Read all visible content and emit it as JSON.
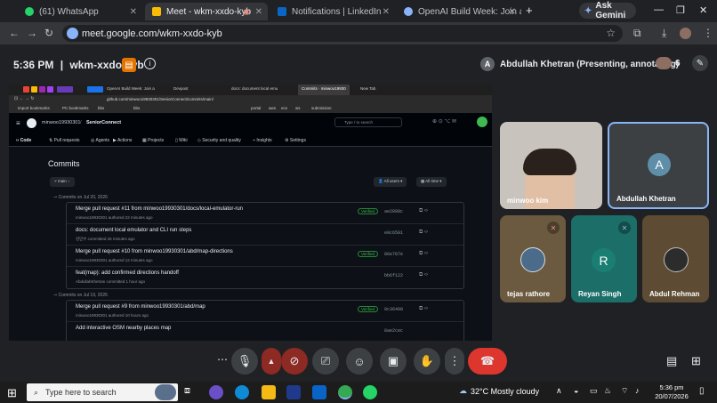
{
  "browser": {
    "tabs": [
      {
        "title": "(61) WhatsApp",
        "icon": "whatsapp-icon",
        "color": "#25d366"
      },
      {
        "title": "Meet - wkm-xxdo-kyb",
        "icon": "meet-icon",
        "color": "#fbbc04",
        "active": true
      },
      {
        "title": "Notifications | LinkedIn",
        "icon": "linkedin-icon",
        "color": "#0a66c2"
      },
      {
        "title": "OpenAI Build Week: Join a glob",
        "icon": "globe-icon",
        "color": "#8ab4f8"
      }
    ],
    "new_tab": "+",
    "ask_gemini": "Ask Gemini",
    "url": "meet.google.com/wkm-xxdo-kyb"
  },
  "meet": {
    "time": "5:36 PM",
    "separator": "|",
    "meeting_code": "wkm-xxdo-kyb",
    "presenter": "Abdullah Khetran (Presenting, annotating)",
    "presenter_initial": "A",
    "participant_count": "6"
  },
  "shared": {
    "inner_tabs": [
      "OpenAI Build Week: Join a",
      "Devpost",
      "docs: document local emu",
      "Commits · minwoo19930",
      "New Tab"
    ],
    "inner_url": "github.com/minwoo19930301/SeniorConnect/commits/main/",
    "bookmarks": [
      "import bookmarks",
      "PC bookmarks",
      "bbs",
      "bbs",
      "portal",
      "aws",
      "ecs",
      "ws",
      "submission"
    ],
    "repo_owner": "minwoo19930301",
    "repo_sep": "/",
    "repo_name": "SeniorConnect",
    "search_placeholder": "Type / to search",
    "nav": [
      "Code",
      "Pull requests",
      "Agents",
      "Actions",
      "Projects",
      "Wiki",
      "Security and quality",
      "Insights",
      "Settings"
    ],
    "page_title": "Commits",
    "branch": "main",
    "all_users": "All users",
    "all_time": "All time",
    "groups": [
      {
        "date": "Commits on Jul 20, 2026",
        "commits": [
          {
            "title": "Merge pull request #11 from minwoo19930301/docs/local-emulator-run",
            "sub": "minwoo19930301 authored 22 minutes ago",
            "verified": "Verified",
            "hash": "ae2898c"
          },
          {
            "title": "docs: document local emulator and CLI run steps",
            "sub": "김민수 committed 26 minutes ago",
            "verified": "",
            "hash": "e0c6501"
          },
          {
            "title": "Merge pull request #10 from minwoo19930301/abd/map-directions",
            "sub": "minwoo19930301 authored 12 minutes ago",
            "verified": "Verified",
            "hash": "86e787e"
          },
          {
            "title": "feat(map): add confirmed directions handoff",
            "sub": "AbdullahKhetran committed 1 hour ago",
            "verified": "",
            "hash": "bb6f122"
          }
        ]
      },
      {
        "date": "Commits on Jul 19, 2026",
        "commits": [
          {
            "title": "Merge pull request #9 from minwoo19930301/abd/map",
            "sub": "minwoo19930301 authored 10 hours ago",
            "verified": "Verified",
            "hash": "9c36408"
          },
          {
            "title": "Add interactive OSM nearby places map",
            "sub": "",
            "verified": "",
            "hash": "8ae2cec"
          }
        ]
      }
    ]
  },
  "participants": [
    {
      "name": "minwoo kim",
      "type": "video"
    },
    {
      "name": "Abdullah Khetran",
      "initial": "A",
      "type": "avatar",
      "color": "#5f8fa8"
    },
    {
      "name": "tejas rathore",
      "type": "photo",
      "muted": true
    },
    {
      "name": "Reyan Singh",
      "initial": "R",
      "type": "avatar",
      "color": "#1a7f72",
      "muted": true
    },
    {
      "name": "Abdul Rehman",
      "type": "photo"
    }
  ],
  "taskbar": {
    "search_placeholder": "Type here to search",
    "weather": "32°C  Mostly cloudy",
    "clock_time": "5:36 pm",
    "clock_date": "20/07/2026"
  }
}
